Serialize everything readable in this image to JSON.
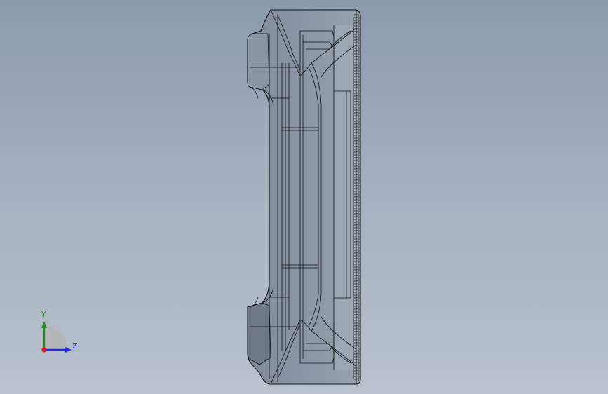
{
  "viewport": {
    "background_top": "#8c9aae",
    "background_bottom": "#b9c2cd",
    "model": "wireframe-shaded-part"
  },
  "triad": {
    "y_label": "Y",
    "z_label": "Z",
    "y_color": "#1f8f1f",
    "z_color": "#1f2fd0",
    "x_color": "#d01f1f"
  }
}
